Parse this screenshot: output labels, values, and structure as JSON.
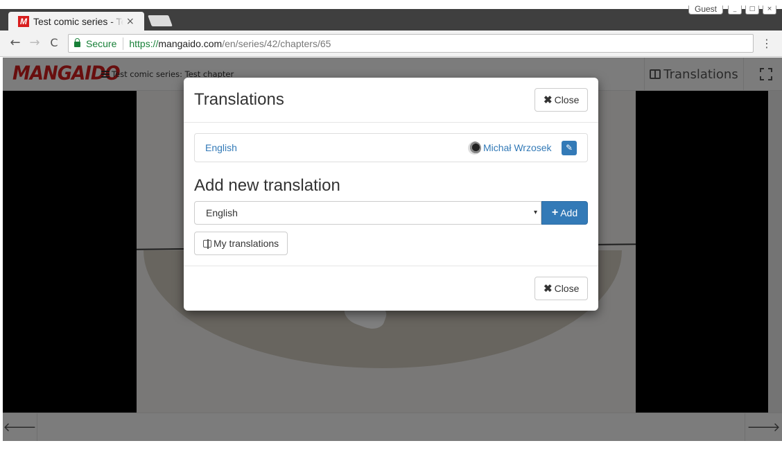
{
  "browser": {
    "tab_title": "Test comic series - Test chapter",
    "tab_close": "×",
    "profile": "Guest",
    "window_controls": {
      "minimize": "_",
      "maximize": "□",
      "close": "×"
    },
    "nav": {
      "back": "←",
      "forward": "→",
      "reload": "C",
      "menu": "⋮"
    },
    "secure_label": "Secure",
    "url": {
      "scheme": "https://",
      "host": "mangaido.com",
      "path": "/en/series/42/chapters/65"
    },
    "icons": [
      "favicon-m-icon",
      "lock-icon",
      "back-icon",
      "forward-icon",
      "reload-icon",
      "menu-icon"
    ]
  },
  "app": {
    "logo": "MANGAIDO",
    "breadcrumb": "Test comic series: Test chapter",
    "header_translations": "Translations",
    "footer": {
      "prev": "🡐",
      "next": "🡒"
    },
    "colors": {
      "logo": "#d11c1c",
      "link": "#337ab7",
      "primary": "#337ab7"
    }
  },
  "modal": {
    "title": "Translations",
    "close_label": "Close",
    "close_glyph": "✖",
    "translations": [
      {
        "language": "English",
        "user": "Michał Wrzosek",
        "edit_glyph": "✎"
      }
    ],
    "add_section_title": "Add new translation",
    "language_select": {
      "selected": "English",
      "arrow": "▾"
    },
    "add_label": "Add",
    "add_glyph": "+",
    "my_translations_label": "My translations"
  }
}
